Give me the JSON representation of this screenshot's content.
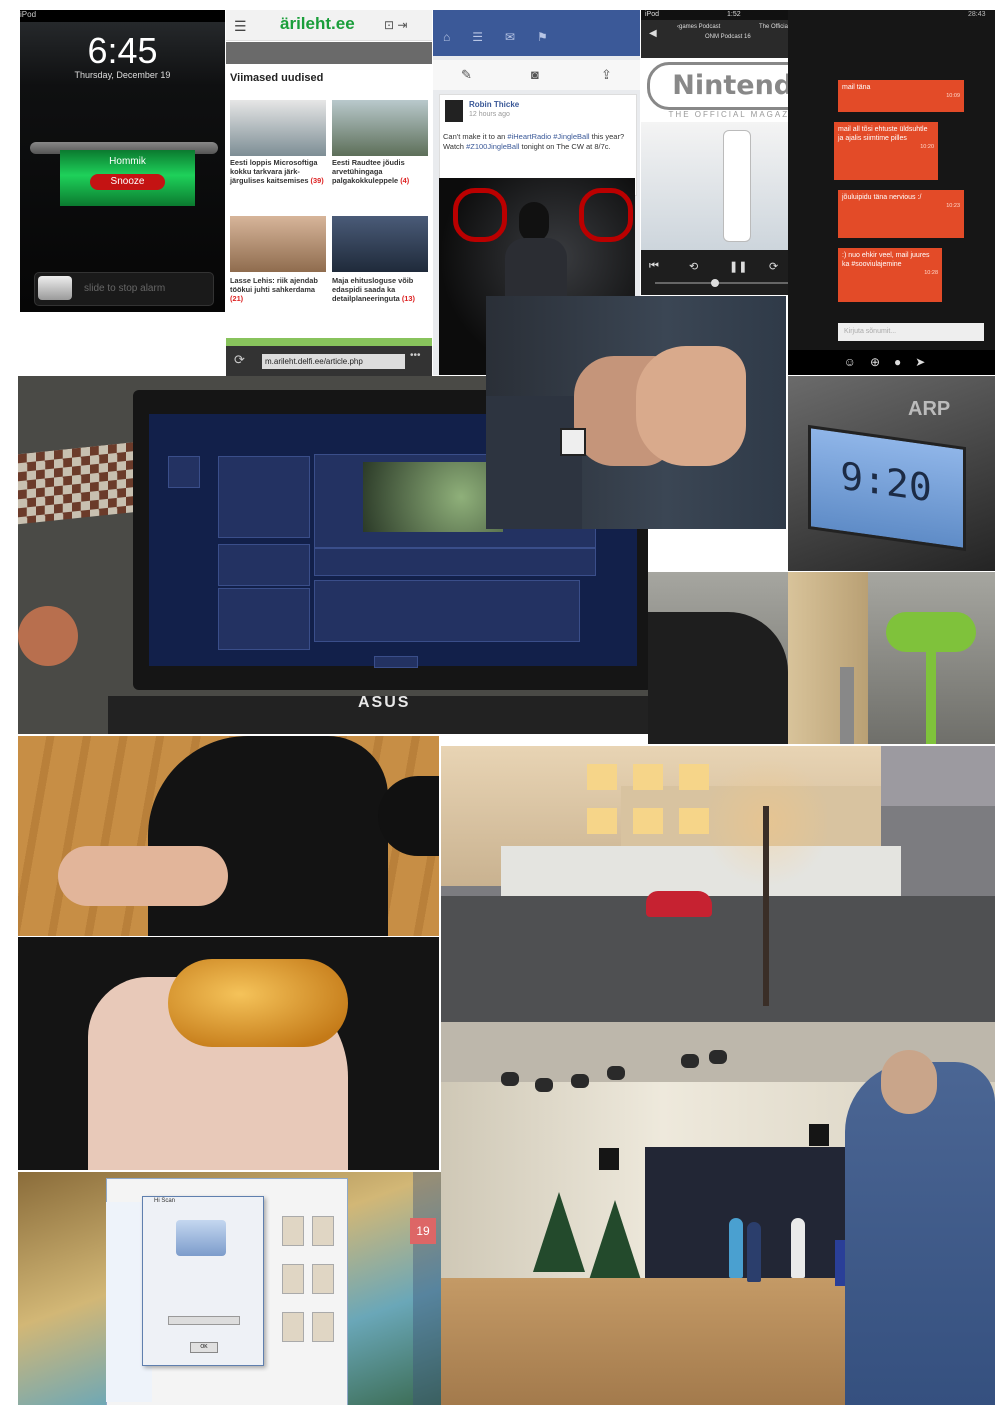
{
  "lock_screen": {
    "device": "iPod",
    "time": "6:45",
    "date": "Thursday, December 19",
    "alarm_label": "Hommik",
    "snooze_label": "Snooze",
    "slider_label": "slide to stop alarm"
  },
  "news": {
    "logo": "ärileht.ee",
    "section_title": "Viimased uudised",
    "articles": [
      {
        "title": "Eesti loppis Microsoftiga kokku tarkvara järk-järgulises kaitsemises",
        "count": "(39)"
      },
      {
        "title": "Eesti Raudtee jõudis arvetühingaga palgakokkuleppele",
        "count": "(4)"
      },
      {
        "title": "Lasse Lehis: riik ajendab töökui juhti sahkerdama",
        "count": "(21)"
      },
      {
        "title": "Maja ehitusloguse võib edaspidi saada ka detailplaneeringuta",
        "count": "(13)"
      }
    ],
    "url": "m.arileht.delfi.ee/article.php"
  },
  "facebook": {
    "author": "Robin Thicke",
    "time": "12 hours ago",
    "text_plain": "Can't make it to an ",
    "hashtags": "#iHeartRadio #JingleBall",
    "text_mid": " this year? Watch ",
    "hashtag2": "#Z100JingleBall",
    "text_end": " tonight on The CW at 8/7c."
  },
  "podcast": {
    "status_left": "iPod",
    "status_time": "1:52",
    "tab1": "‹games Podcast",
    "tab2": "The Official N",
    "subtitle": "ONM Podcast 16",
    "logo": "Nintendo",
    "magazine": "THE OFFICIAL MAGAZINE",
    "controls": "⏮ ⟲ ❚❚ ⟳ ⏭"
  },
  "chat": {
    "status_left": "28:43",
    "messages": [
      {
        "text": "mail täna",
        "time": "10:09"
      },
      {
        "text": "mail all tõsi ehtuste üldsuhtle ja ajalis siimtime pilles",
        "time": "10:20"
      },
      {
        "text": "jõuluipidu täna nervious :/",
        "time": "10:23"
      },
      {
        "text": ":) nuo ehkir veel, mail juures ka #sooviulajemine",
        "time": "10:28"
      }
    ],
    "input_placeholder": "Kirjuta sõnumit..."
  },
  "laptop": {
    "brand": "ASUS"
  },
  "clock": {
    "brand": "ARP",
    "time": "9:20"
  },
  "desktop": {
    "calendar_day": "19",
    "dialog_title": "Hi Scan",
    "ok_label": "OK"
  }
}
